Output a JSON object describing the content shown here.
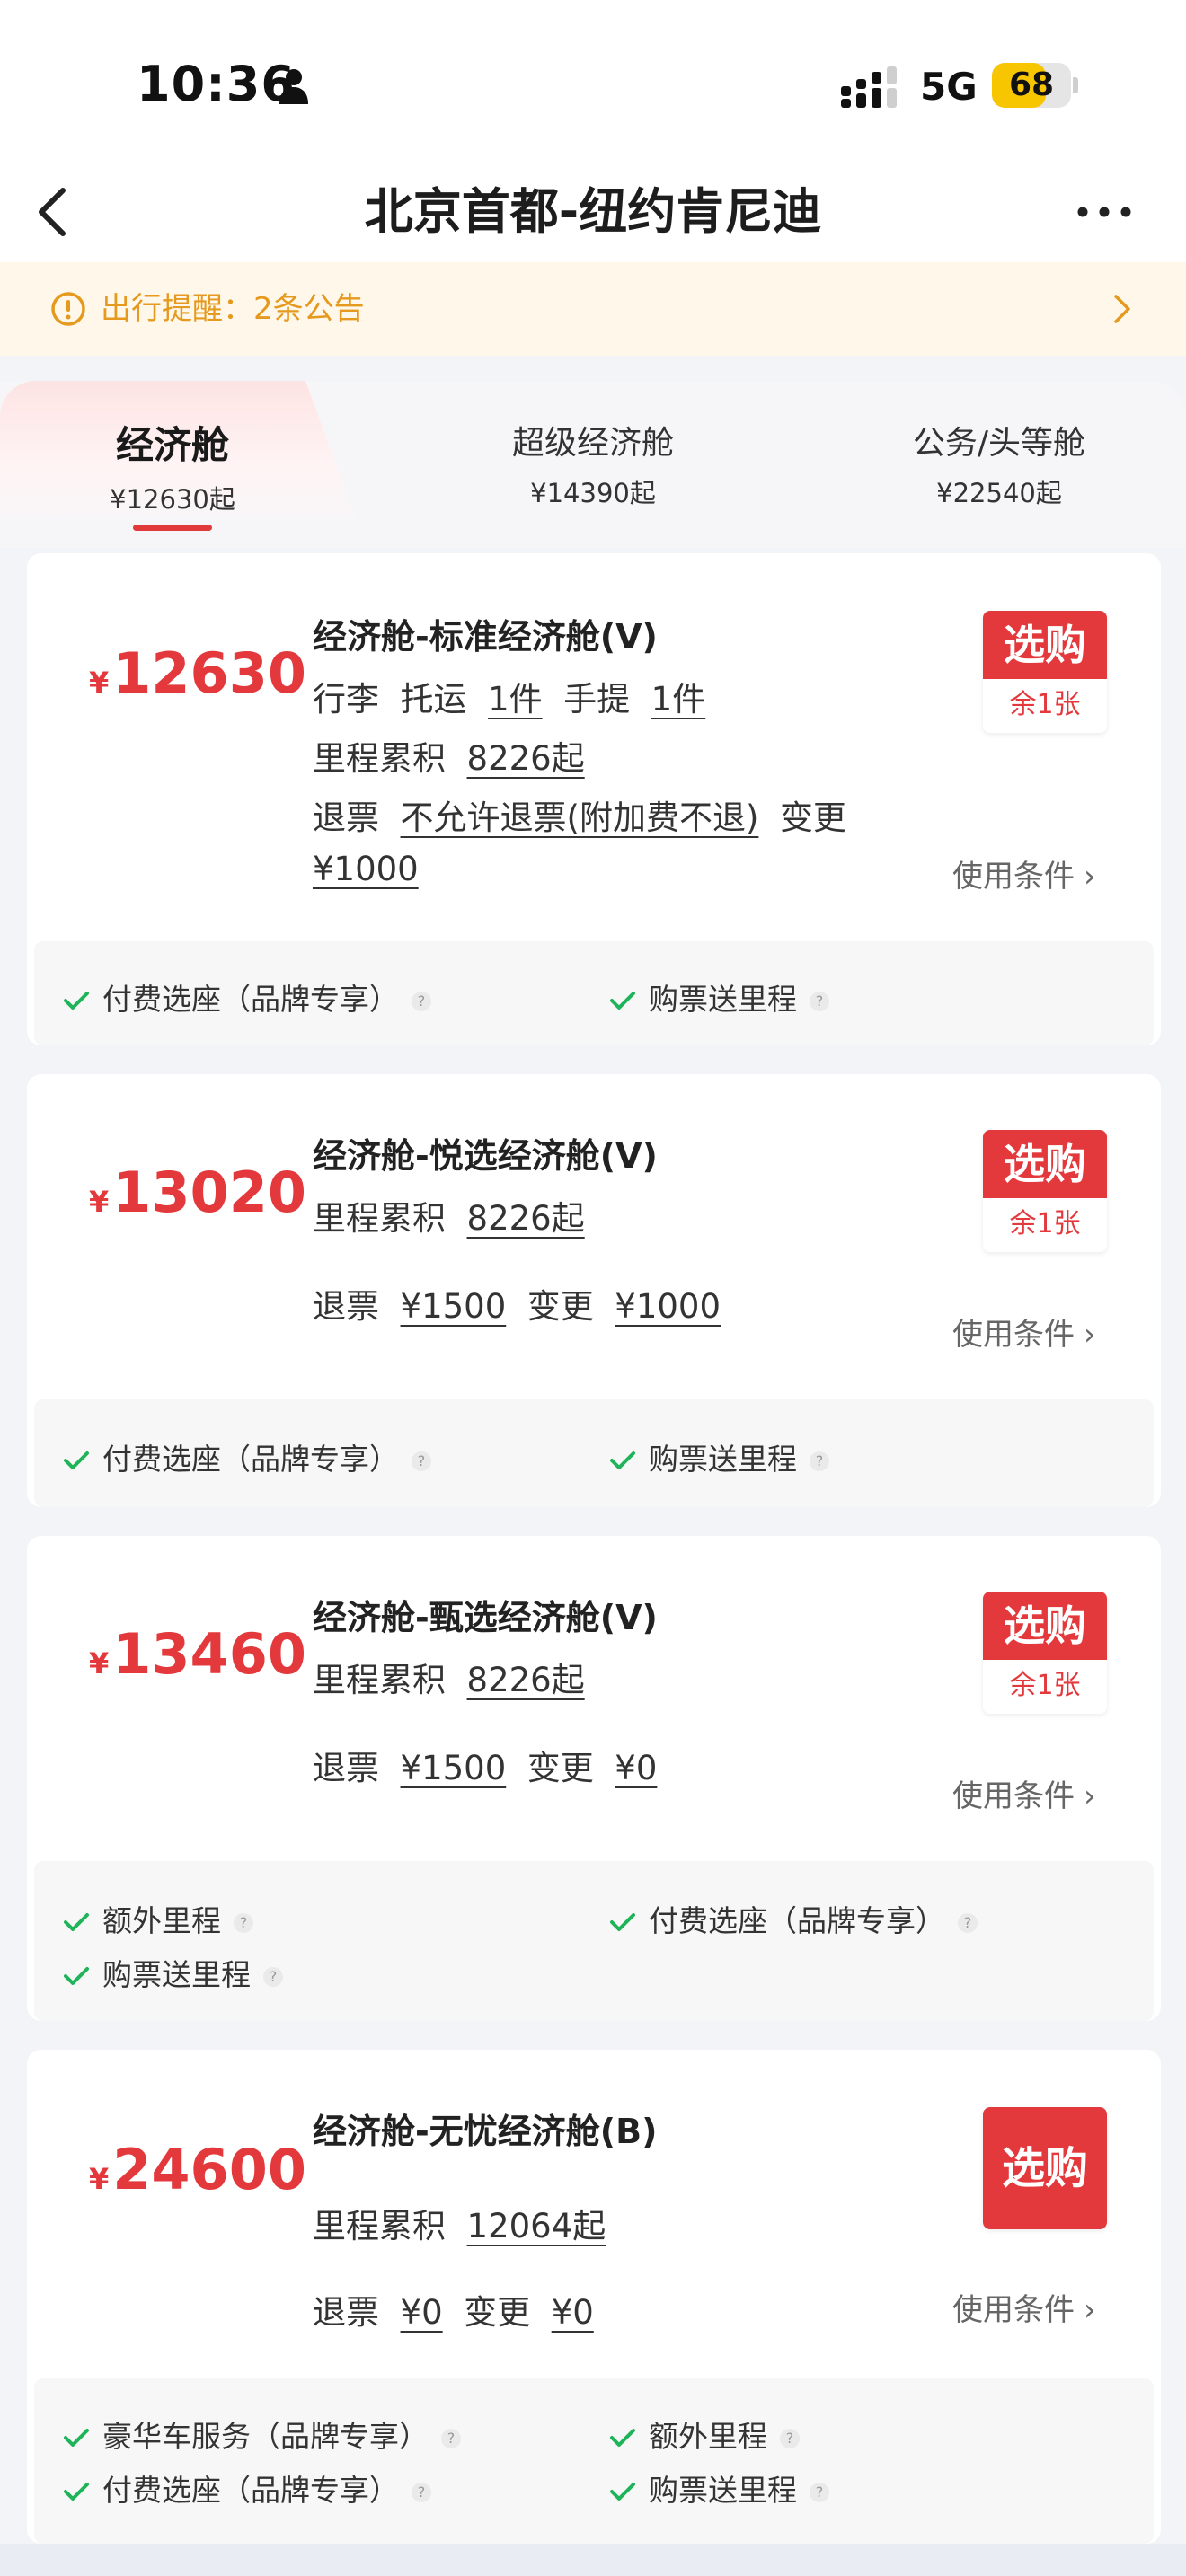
{
  "status_bar": {
    "time": "10:36",
    "network": "5G",
    "battery": "68",
    "battery_level": 0.68
  },
  "nav": {
    "title": "北京首都-纽约肯尼迪"
  },
  "notice": {
    "text": "出行提醒：2条公告"
  },
  "tabs": [
    {
      "name": "经济舱",
      "price": "¥12630起",
      "active": true
    },
    {
      "name": "超级经济舱",
      "price": "¥14390起",
      "active": false
    },
    {
      "name": "公务/头等舱",
      "price": "¥22540起",
      "active": false
    }
  ],
  "fares": [
    {
      "yen": "¥",
      "price": "12630",
      "title": "经济舱-标准经济舱(V)",
      "baggage": {
        "label": "行李",
        "checked_label": "托运",
        "checked": "1件",
        "carry_label": "手提",
        "carry": "1件"
      },
      "mileage": {
        "label": "里程累积",
        "value": "8226起"
      },
      "refund": {
        "label": "退票",
        "value": "不允许退票(附加费不退)",
        "change_label": "变更",
        "change": "¥1000"
      },
      "buy": "选购",
      "remain": "余1张",
      "conditions": "使用条件",
      "features": [
        "付费选座（品牌专享）",
        "购票送里程"
      ]
    },
    {
      "yen": "¥",
      "price": "13020",
      "title": "经济舱-悦选经济舱(V)",
      "mileage": {
        "label": "里程累积",
        "value": "8226起"
      },
      "refund": {
        "label": "退票",
        "value": "¥1500",
        "change_label": "变更",
        "change": "¥1000"
      },
      "buy": "选购",
      "remain": "余1张",
      "conditions": "使用条件",
      "features": [
        "付费选座（品牌专享）",
        "购票送里程"
      ]
    },
    {
      "yen": "¥",
      "price": "13460",
      "title": "经济舱-甄选经济舱(V)",
      "mileage": {
        "label": "里程累积",
        "value": "8226起"
      },
      "refund": {
        "label": "退票",
        "value": "¥1500",
        "change_label": "变更",
        "change": "¥0"
      },
      "buy": "选购",
      "remain": "余1张",
      "conditions": "使用条件",
      "features": [
        "额外里程",
        "付费选座（品牌专享）",
        "购票送里程"
      ]
    },
    {
      "yen": "¥",
      "price": "24600",
      "title": "经济舱-无忧经济舱(B)",
      "mileage": {
        "label": "里程累积",
        "value": "12064起"
      },
      "refund": {
        "label": "退票",
        "value": "¥0",
        "change_label": "变更",
        "change": "¥0"
      },
      "buy": "选购",
      "conditions": "使用条件",
      "features": [
        "豪华车服务（品牌专享）",
        "额外里程",
        "付费选座（品牌专享）",
        "购票送里程"
      ]
    }
  ],
  "colors": {
    "accent": "#e3393c",
    "notice": "#e59a1f",
    "check": "#1fb35a",
    "battery": "#f7c600"
  }
}
